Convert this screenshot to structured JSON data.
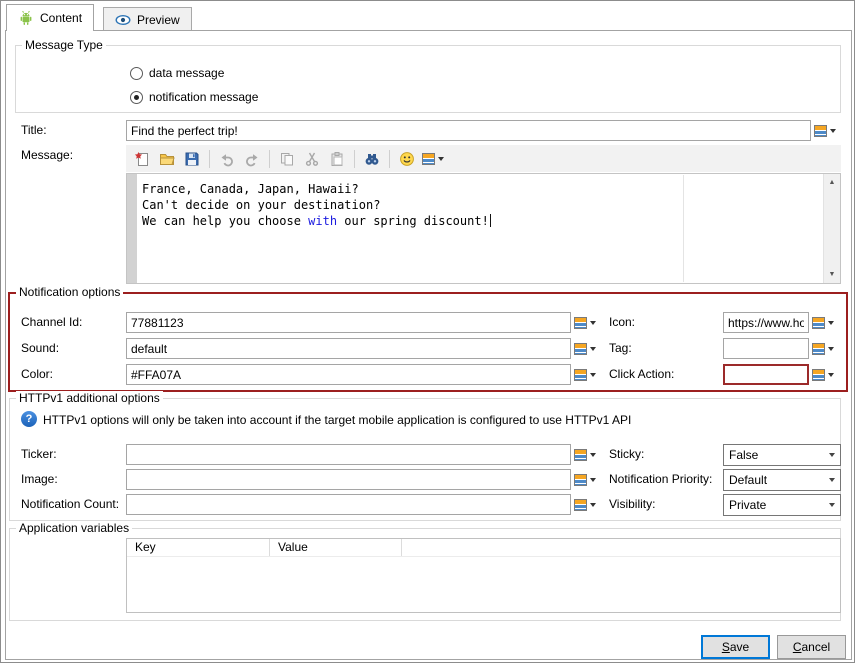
{
  "colors": {
    "accent": "#0078d7",
    "highlight_red": "#9c1f1f",
    "keyword_blue": "#1a1adf",
    "android_green": "#8bc34a"
  },
  "tabs": {
    "content": {
      "label": "Content",
      "icon": "android-robot",
      "active": true
    },
    "preview": {
      "label": "Preview",
      "icon": "eye",
      "active": false
    }
  },
  "message_type": {
    "legend": "Message Type",
    "options": [
      {
        "label": "data message",
        "selected": false
      },
      {
        "label": "notification message",
        "selected": true
      }
    ]
  },
  "title_row": {
    "label": "Title:",
    "value": "Find the perfect trip!"
  },
  "message_row": {
    "label": "Message:",
    "toolbar_icons": [
      "new-document",
      "open-folder",
      "save",
      "undo",
      "redo",
      "copy",
      "cut",
      "paste",
      "find-binoculars",
      "emoticon",
      "insert-variable"
    ],
    "text": {
      "line1": "France, Canada, Japan, Hawaii?",
      "line2": "Can't decide on your destination?",
      "line3_before": "We can help you choose ",
      "line3_highlight": "with",
      "line3_after": " our spring discount!"
    }
  },
  "notification_options": {
    "legend": "Notification options",
    "channel_id": {
      "label": "Channel Id:",
      "value": "77881123"
    },
    "sound": {
      "label": "Sound:",
      "value": "default"
    },
    "color": {
      "label": "Color:",
      "value": "#FFA07A"
    },
    "icon": {
      "label": "Icon:",
      "value": "https://www.ho"
    },
    "tag": {
      "label": "Tag:",
      "value": ""
    },
    "click_action": {
      "label": "Click Action:",
      "value": ""
    }
  },
  "httpv1_options": {
    "legend": "HTTPv1 additional options",
    "help_glyph": "?",
    "info": "HTTPv1 options will only be taken into account if the target mobile application is configured to use HTTPv1 API",
    "ticker": {
      "label": "Ticker:",
      "value": ""
    },
    "image": {
      "label": "Image:",
      "value": ""
    },
    "notification_count": {
      "label": "Notification Count:",
      "value": ""
    },
    "sticky": {
      "label": "Sticky:",
      "value": "False"
    },
    "notification_priority": {
      "label": "Notification Priority:",
      "value": "Default"
    },
    "visibility": {
      "label": "Visibility:",
      "value": "Private"
    }
  },
  "application_variables": {
    "legend": "Application variables",
    "columns": [
      "Key",
      "Value"
    ]
  },
  "footer": {
    "save": "Save",
    "cancel": "Cancel"
  }
}
